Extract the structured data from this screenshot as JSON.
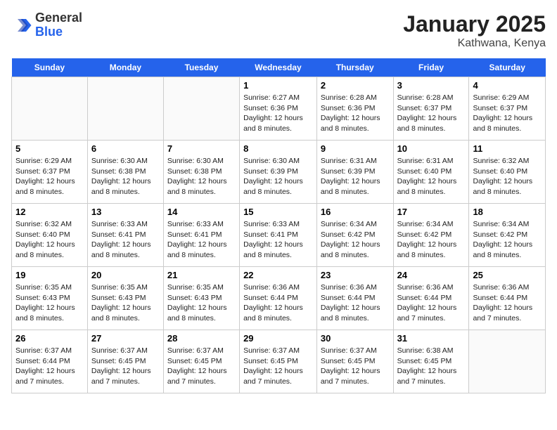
{
  "header": {
    "logo_general": "General",
    "logo_blue": "Blue",
    "title": "January 2025",
    "subtitle": "Kathwana, Kenya"
  },
  "days": [
    "Sunday",
    "Monday",
    "Tuesday",
    "Wednesday",
    "Thursday",
    "Friday",
    "Saturday"
  ],
  "weeks": [
    [
      {
        "date": "",
        "text": ""
      },
      {
        "date": "",
        "text": ""
      },
      {
        "date": "",
        "text": ""
      },
      {
        "date": "1",
        "text": "Sunrise: 6:27 AM\nSunset: 6:36 PM\nDaylight: 12 hours and 8 minutes."
      },
      {
        "date": "2",
        "text": "Sunrise: 6:28 AM\nSunset: 6:36 PM\nDaylight: 12 hours and 8 minutes."
      },
      {
        "date": "3",
        "text": "Sunrise: 6:28 AM\nSunset: 6:37 PM\nDaylight: 12 hours and 8 minutes."
      },
      {
        "date": "4",
        "text": "Sunrise: 6:29 AM\nSunset: 6:37 PM\nDaylight: 12 hours and 8 minutes."
      }
    ],
    [
      {
        "date": "5",
        "text": "Sunrise: 6:29 AM\nSunset: 6:37 PM\nDaylight: 12 hours and 8 minutes."
      },
      {
        "date": "6",
        "text": "Sunrise: 6:30 AM\nSunset: 6:38 PM\nDaylight: 12 hours and 8 minutes."
      },
      {
        "date": "7",
        "text": "Sunrise: 6:30 AM\nSunset: 6:38 PM\nDaylight: 12 hours and 8 minutes."
      },
      {
        "date": "8",
        "text": "Sunrise: 6:30 AM\nSunset: 6:39 PM\nDaylight: 12 hours and 8 minutes."
      },
      {
        "date": "9",
        "text": "Sunrise: 6:31 AM\nSunset: 6:39 PM\nDaylight: 12 hours and 8 minutes."
      },
      {
        "date": "10",
        "text": "Sunrise: 6:31 AM\nSunset: 6:40 PM\nDaylight: 12 hours and 8 minutes."
      },
      {
        "date": "11",
        "text": "Sunrise: 6:32 AM\nSunset: 6:40 PM\nDaylight: 12 hours and 8 minutes."
      }
    ],
    [
      {
        "date": "12",
        "text": "Sunrise: 6:32 AM\nSunset: 6:40 PM\nDaylight: 12 hours and 8 minutes."
      },
      {
        "date": "13",
        "text": "Sunrise: 6:33 AM\nSunset: 6:41 PM\nDaylight: 12 hours and 8 minutes."
      },
      {
        "date": "14",
        "text": "Sunrise: 6:33 AM\nSunset: 6:41 PM\nDaylight: 12 hours and 8 minutes."
      },
      {
        "date": "15",
        "text": "Sunrise: 6:33 AM\nSunset: 6:41 PM\nDaylight: 12 hours and 8 minutes."
      },
      {
        "date": "16",
        "text": "Sunrise: 6:34 AM\nSunset: 6:42 PM\nDaylight: 12 hours and 8 minutes."
      },
      {
        "date": "17",
        "text": "Sunrise: 6:34 AM\nSunset: 6:42 PM\nDaylight: 12 hours and 8 minutes."
      },
      {
        "date": "18",
        "text": "Sunrise: 6:34 AM\nSunset: 6:42 PM\nDaylight: 12 hours and 8 minutes."
      }
    ],
    [
      {
        "date": "19",
        "text": "Sunrise: 6:35 AM\nSunset: 6:43 PM\nDaylight: 12 hours and 8 minutes."
      },
      {
        "date": "20",
        "text": "Sunrise: 6:35 AM\nSunset: 6:43 PM\nDaylight: 12 hours and 8 minutes."
      },
      {
        "date": "21",
        "text": "Sunrise: 6:35 AM\nSunset: 6:43 PM\nDaylight: 12 hours and 8 minutes."
      },
      {
        "date": "22",
        "text": "Sunrise: 6:36 AM\nSunset: 6:44 PM\nDaylight: 12 hours and 8 minutes."
      },
      {
        "date": "23",
        "text": "Sunrise: 6:36 AM\nSunset: 6:44 PM\nDaylight: 12 hours and 8 minutes."
      },
      {
        "date": "24",
        "text": "Sunrise: 6:36 AM\nSunset: 6:44 PM\nDaylight: 12 hours and 7 minutes."
      },
      {
        "date": "25",
        "text": "Sunrise: 6:36 AM\nSunset: 6:44 PM\nDaylight: 12 hours and 7 minutes."
      }
    ],
    [
      {
        "date": "26",
        "text": "Sunrise: 6:37 AM\nSunset: 6:44 PM\nDaylight: 12 hours and 7 minutes."
      },
      {
        "date": "27",
        "text": "Sunrise: 6:37 AM\nSunset: 6:45 PM\nDaylight: 12 hours and 7 minutes."
      },
      {
        "date": "28",
        "text": "Sunrise: 6:37 AM\nSunset: 6:45 PM\nDaylight: 12 hours and 7 minutes."
      },
      {
        "date": "29",
        "text": "Sunrise: 6:37 AM\nSunset: 6:45 PM\nDaylight: 12 hours and 7 minutes."
      },
      {
        "date": "30",
        "text": "Sunrise: 6:37 AM\nSunset: 6:45 PM\nDaylight: 12 hours and 7 minutes."
      },
      {
        "date": "31",
        "text": "Sunrise: 6:38 AM\nSunset: 6:45 PM\nDaylight: 12 hours and 7 minutes."
      },
      {
        "date": "",
        "text": ""
      }
    ]
  ]
}
